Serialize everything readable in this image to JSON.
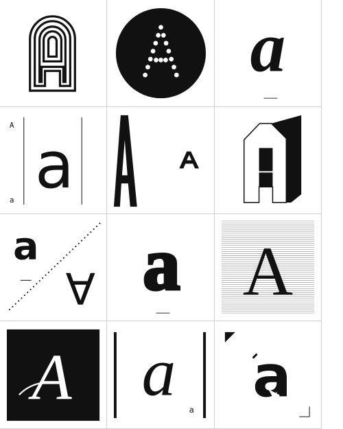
{
  "tiles": [
    {
      "name": "concentric-arch-a",
      "glyph": "A"
    },
    {
      "name": "dotted-a-in-circle",
      "glyph": "A"
    },
    {
      "name": "bold-italic-lowercase-a",
      "glyph": "a"
    },
    {
      "name": "specimen-a-with-rules",
      "glyph": "a",
      "label_top": "A",
      "label_bottom": "a"
    },
    {
      "name": "condensed-a-and-wide-a",
      "glyph": "A",
      "small": "A"
    },
    {
      "name": "3d-block-a",
      "glyph": "A"
    },
    {
      "name": "diagonal-a-and-inverted-a",
      "glyph": "a",
      "inverted": "A"
    },
    {
      "name": "heavy-lowercase-a",
      "glyph": "a"
    },
    {
      "name": "striped-serif-a",
      "glyph": "A"
    },
    {
      "name": "script-a-on-black",
      "glyph": "A"
    },
    {
      "name": "italic-a-between-bars",
      "glyph": "a",
      "small": "a"
    },
    {
      "name": "stencil-a-with-corners",
      "glyph": "a"
    }
  ]
}
